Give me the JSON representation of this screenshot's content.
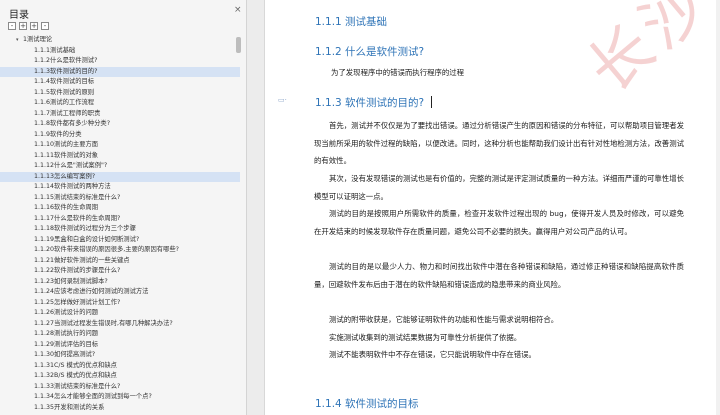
{
  "toc": {
    "title": "目录",
    "close_icon": "×",
    "tools": [
      "-",
      "+",
      "+",
      "-"
    ],
    "root": "1测试理论",
    "items": [
      "1.1.1测试基础",
      "1.1.2什么是软件测试?",
      "1.1.3软件测试的目的?",
      "1.1.4软件测试的目标",
      "1.1.5软件测试的原则",
      "1.1.6测试的工作流程",
      "1.1.7测试工程师的职责",
      "1.1.8软件都有多少种分类?",
      "1.1.9软件的分类",
      "1.1.10测试的主要方面",
      "1.1.11软件测试的对象",
      "1.1.12什么是\"测试案例\"?",
      "1.1.13怎么编写案例?",
      "1.1.14软件测试的两种方法",
      "1.1.15测试结束的标准是什么?",
      "1.1.16软件的生命周期",
      "1.1.17什么是软件的生命周期?",
      "1.1.18软件测试的过程分为三个步骤",
      "1.1.19黑盒和白盒的设计如何断测试?",
      "1.1.20软件带来错误的原因很多,主要的原因有哪些?",
      "1.1.21做好软件测试的一些关键点",
      "1.1.22软件测试的步骤是什么?",
      "1.1.23如何录制测试脚本?",
      "1.1.24应该考虑进行如何测试的测试方法",
      "1.1.25怎样做好测试计划工作?",
      "1.1.26测试设计的问题",
      "1.1.27当测试过程发生错误时,有哪几种解决办法?",
      "1.1.28测试执行的问题",
      "1.1.29测试评估的目标",
      "1.1.30如何提高测试?",
      "1.1.31C/S 模式的优点和缺点",
      "1.1.32B/S 模式的优点和缺点",
      "1.1.33测试结束的标准是什么?",
      "1.1.34怎么才能够全面的测试到每一个点?",
      "1.1.35开发和测试的关系"
    ],
    "active_items": [
      "1.1.3软件测试的目的?",
      "1.1.13怎么编写案例?"
    ]
  },
  "doc": {
    "h_111": "1.1.1  测试基础",
    "h_112": "1.1.2  什么是软件测试?",
    "p_112": "为了发现程序中的错误而执行程序的过程",
    "h_113": "1.1.3  软件测试的目的?",
    "p1": "首先，测试并不仅仅是为了要找出错误。通过分析错误产生的原因和错误的分布特征，可以帮助项目管理者发现当前所采用的软件过程的缺陷，以便改进。同时，这种分析也能帮助我们设计出有针对性地检测方法，改善测试的有效性。",
    "p2": "其次，没有发现错误的测试也是有价值的，完整的测试是评定测试质量的一种方法。详细而严谨的可靠性增长模型可以证明这一点。",
    "p3": "测试的目的是按照用户所需软件的质量，检查开发软件过程出现的 bug，使得开发人员及时修改，可以避免在开发结束的时候发现软件存在质量问题，避免公司不必要的损失。赢得用户对公司产品的认可。",
    "p4": "测试的目的是以最少人力、物力和时间找出软件中潜在各种错误和缺陷，通过修正种错误和缺陷提高软件质量，回避软件发布后由于潜在的软件缺陷和错误造成的隐患带来的商业风险。",
    "p5": "测试的附带收获是，它能够证明软件的功能和性能与需求说明相符合。",
    "p6": "实施测试收集到的测试结果数据为可靠性分析提供了依据。",
    "p7": "测试不能表明软件中不存在错误，它只能说明软件中存在错误。",
    "h_114": "1.1.4  软件测试的目标",
    "watermark": "长沙测试测试"
  },
  "colors": {
    "heading": "#2f74b7",
    "active": "#d5e2f4",
    "watermark": "#f2c4c4"
  }
}
